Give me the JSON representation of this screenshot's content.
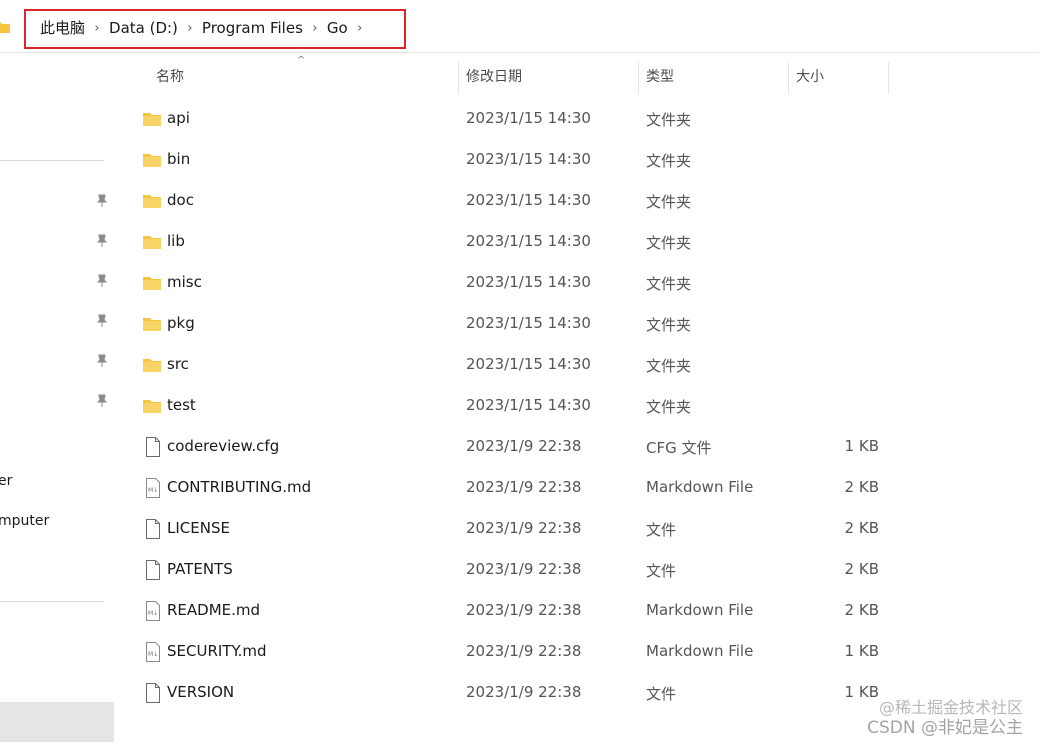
{
  "breadcrumb": {
    "items": [
      "此电脑",
      "Data (D:)",
      "Program Files",
      "Go"
    ]
  },
  "columns": {
    "name": "名称",
    "modified": "修改日期",
    "type": "类型",
    "size": "大小"
  },
  "nav": {
    "partial_labels": [
      "er",
      "mputer"
    ]
  },
  "files": [
    {
      "name": "api",
      "modified": "2023/1/15 14:30",
      "type": "文件夹",
      "size": "",
      "icon": "folder-icon"
    },
    {
      "name": "bin",
      "modified": "2023/1/15 14:30",
      "type": "文件夹",
      "size": "",
      "icon": "folder-icon"
    },
    {
      "name": "doc",
      "modified": "2023/1/15 14:30",
      "type": "文件夹",
      "size": "",
      "icon": "folder-icon"
    },
    {
      "name": "lib",
      "modified": "2023/1/15 14:30",
      "type": "文件夹",
      "size": "",
      "icon": "folder-icon"
    },
    {
      "name": "misc",
      "modified": "2023/1/15 14:30",
      "type": "文件夹",
      "size": "",
      "icon": "folder-icon"
    },
    {
      "name": "pkg",
      "modified": "2023/1/15 14:30",
      "type": "文件夹",
      "size": "",
      "icon": "folder-icon"
    },
    {
      "name": "src",
      "modified": "2023/1/15 14:30",
      "type": "文件夹",
      "size": "",
      "icon": "folder-icon"
    },
    {
      "name": "test",
      "modified": "2023/1/15 14:30",
      "type": "文件夹",
      "size": "",
      "icon": "folder-icon"
    },
    {
      "name": "codereview.cfg",
      "modified": "2023/1/9 22:38",
      "type": "CFG 文件",
      "size": "1 KB",
      "icon": "file-icon"
    },
    {
      "name": "CONTRIBUTING.md",
      "modified": "2023/1/9 22:38",
      "type": "Markdown File",
      "size": "2 KB",
      "icon": "markdown-file-icon"
    },
    {
      "name": "LICENSE",
      "modified": "2023/1/9 22:38",
      "type": "文件",
      "size": "2 KB",
      "icon": "file-icon"
    },
    {
      "name": "PATENTS",
      "modified": "2023/1/9 22:38",
      "type": "文件",
      "size": "2 KB",
      "icon": "file-icon"
    },
    {
      "name": "README.md",
      "modified": "2023/1/9 22:38",
      "type": "Markdown File",
      "size": "2 KB",
      "icon": "markdown-file-icon"
    },
    {
      "name": "SECURITY.md",
      "modified": "2023/1/9 22:38",
      "type": "Markdown File",
      "size": "1 KB",
      "icon": "markdown-file-icon"
    },
    {
      "name": "VERSION",
      "modified": "2023/1/9 22:38",
      "type": "文件",
      "size": "1 KB",
      "icon": "file-icon"
    }
  ],
  "watermark": {
    "line1": "@稀土掘金技术社区",
    "line2": "CSDN @非妃是公主"
  },
  "colors": {
    "highlight_box": "#d9262c",
    "folder": "#f5c542",
    "selected_nav": "#e5e5e5"
  }
}
